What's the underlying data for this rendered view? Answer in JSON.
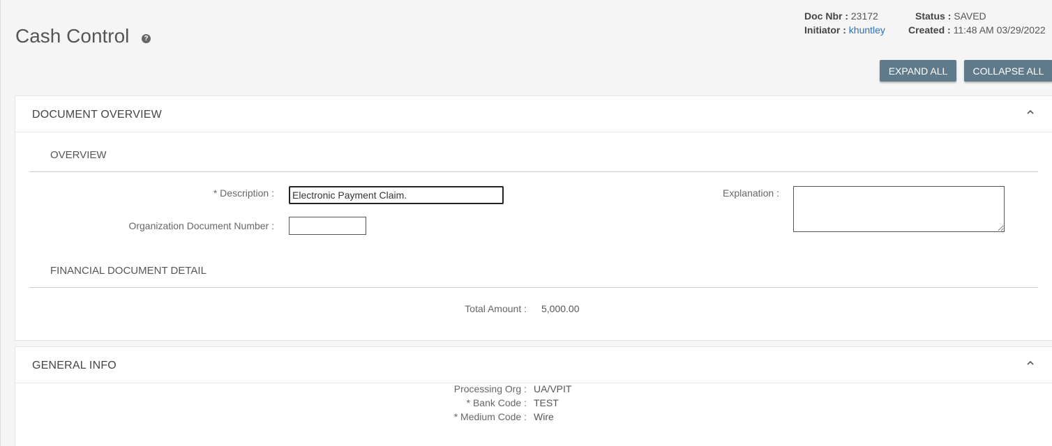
{
  "page": {
    "title": "Cash Control",
    "help_icon": "question-icon"
  },
  "doc_info": {
    "doc_nbr_label": "Doc Nbr :",
    "doc_nbr": "23172",
    "initiator_label": "Initiator :",
    "initiator": "khuntley",
    "status_label": "Status :",
    "status": "SAVED",
    "created_label": "Created :",
    "created": "11:48 AM 03/29/2022"
  },
  "toolbar": {
    "expand_all": "EXPAND ALL",
    "collapse_all": "COLLAPSE ALL"
  },
  "document_overview": {
    "title": "DOCUMENT OVERVIEW",
    "overview_title": "OVERVIEW",
    "description_label": "* Description :",
    "description_value": "Electronic Payment Claim.",
    "org_doc_number_label": "Organization Document Number :",
    "org_doc_number_value": "",
    "explanation_label": "Explanation :",
    "explanation_value": "",
    "financial_detail_title": "FINANCIAL DOCUMENT DETAIL",
    "total_amount_label": "Total Amount :",
    "total_amount": "5,000.00"
  },
  "general_info": {
    "title": "GENERAL INFO",
    "processing_org_label": "Processing Org :",
    "processing_org": "UA/VPIT",
    "bank_code_label": "* Bank Code :",
    "bank_code": "TEST",
    "medium_code_label": "* Medium Code :",
    "medium_code": "Wire"
  },
  "colors": {
    "button_bg": "#5f7a8a",
    "link": "#2f6fb5",
    "page_bg": "#f5f5f5"
  }
}
